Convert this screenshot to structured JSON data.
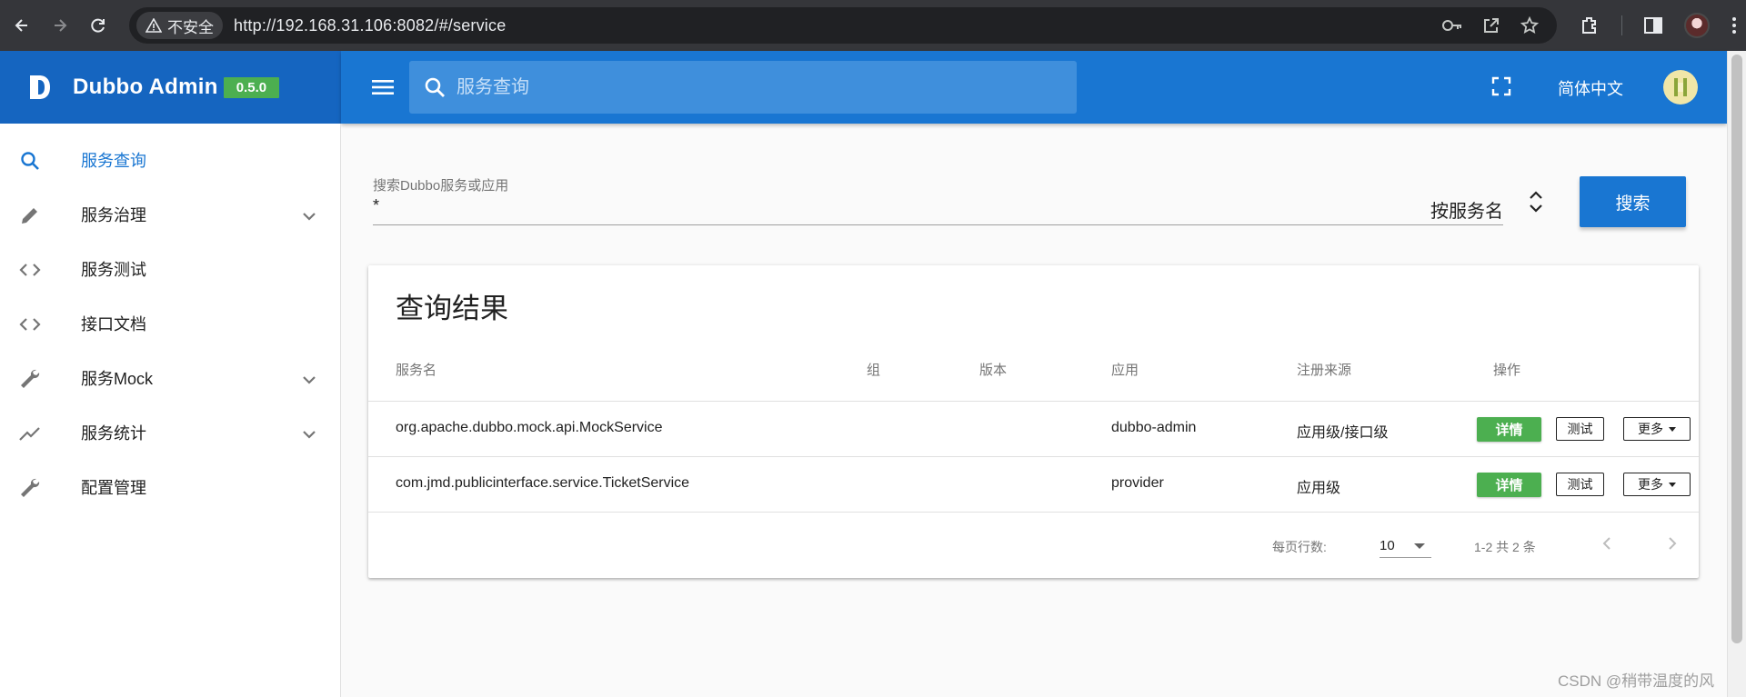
{
  "browser": {
    "security_label": "不安全",
    "url": "http://192.168.31.106:8082/#/service"
  },
  "app": {
    "brand_title": "Dubbo Admin",
    "version": "0.5.0",
    "search_placeholder": "服务查询",
    "language": "简体中文"
  },
  "sidebar": {
    "items": [
      {
        "label": "服务查询",
        "icon": "search-icon",
        "expandable": false,
        "active": true
      },
      {
        "label": "服务治理",
        "icon": "pencil-icon",
        "expandable": true,
        "active": false
      },
      {
        "label": "服务测试",
        "icon": "code-icon",
        "expandable": false,
        "active": false
      },
      {
        "label": "接口文档",
        "icon": "code-icon",
        "expandable": false,
        "active": false
      },
      {
        "label": "服务Mock",
        "icon": "wrench-icon",
        "expandable": true,
        "active": false
      },
      {
        "label": "服务统计",
        "icon": "trending-icon",
        "expandable": true,
        "active": false
      },
      {
        "label": "配置管理",
        "icon": "wrench-icon",
        "expandable": false,
        "active": false
      }
    ]
  },
  "search": {
    "label": "搜索Dubbo服务或应用",
    "value": "*",
    "mode": "按服务名",
    "button_label": "搜索"
  },
  "results": {
    "title": "查询结果",
    "headers": {
      "service": "服务名",
      "group": "组",
      "version": "版本",
      "application": "应用",
      "registry_source": "注册来源",
      "operation": "操作"
    },
    "rows": [
      {
        "service": "org.apache.dubbo.mock.api.MockService",
        "group": "",
        "version": "",
        "application": "dubbo-admin",
        "registry_source": "应用级/接口级",
        "detail_label": "详情",
        "test_label": "测试",
        "more_label": "更多"
      },
      {
        "service": "com.jmd.publicinterface.service.TicketService",
        "group": "",
        "version": "",
        "application": "provider",
        "registry_source": "应用级",
        "detail_label": "详情",
        "test_label": "测试",
        "more_label": "更多"
      }
    ],
    "pagination": {
      "rows_per_page_label": "每页行数:",
      "rows_per_page": "10",
      "range_text": "1-2 共 2 条"
    }
  },
  "watermark": "CSDN @稍带温度的风",
  "colors": {
    "brand_dark": "#1565c0",
    "primary": "#1976d2",
    "success": "#4caf50"
  }
}
